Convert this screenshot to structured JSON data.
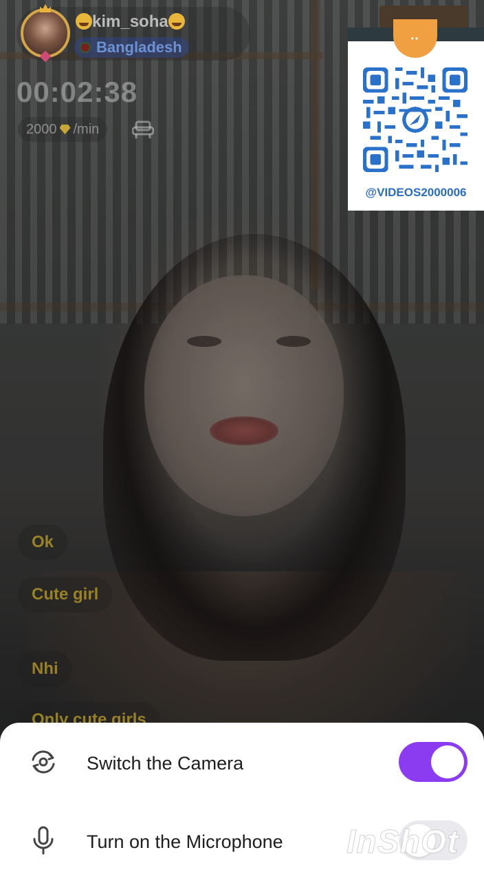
{
  "caller": {
    "username": "kim_soha",
    "country": "Bangladesh"
  },
  "call": {
    "timer": "00:02:38",
    "rate": "2000",
    "rate_unit": "/min"
  },
  "promo": {
    "handle": "@VIDEOS2000006"
  },
  "chat": {
    "messages": [
      "Ok",
      "Cute girl",
      "Nhi",
      "Only cute girls"
    ]
  },
  "settings": {
    "switch_camera_label": "Switch the Camera",
    "switch_camera_on": true,
    "microphone_label": "Turn on the Microphone",
    "microphone_on": false
  },
  "watermark": "InShOt",
  "colors": {
    "toggle_on": "#8b3cf0",
    "toggle_off": "#e9e9ee",
    "chat_text": "#bea028",
    "qr_blue": "#2a6dbf"
  },
  "icons": {
    "camera_switch": "camera-switch-icon",
    "microphone": "microphone-icon",
    "sofa": "sofa-icon",
    "gem": "gem-icon"
  }
}
